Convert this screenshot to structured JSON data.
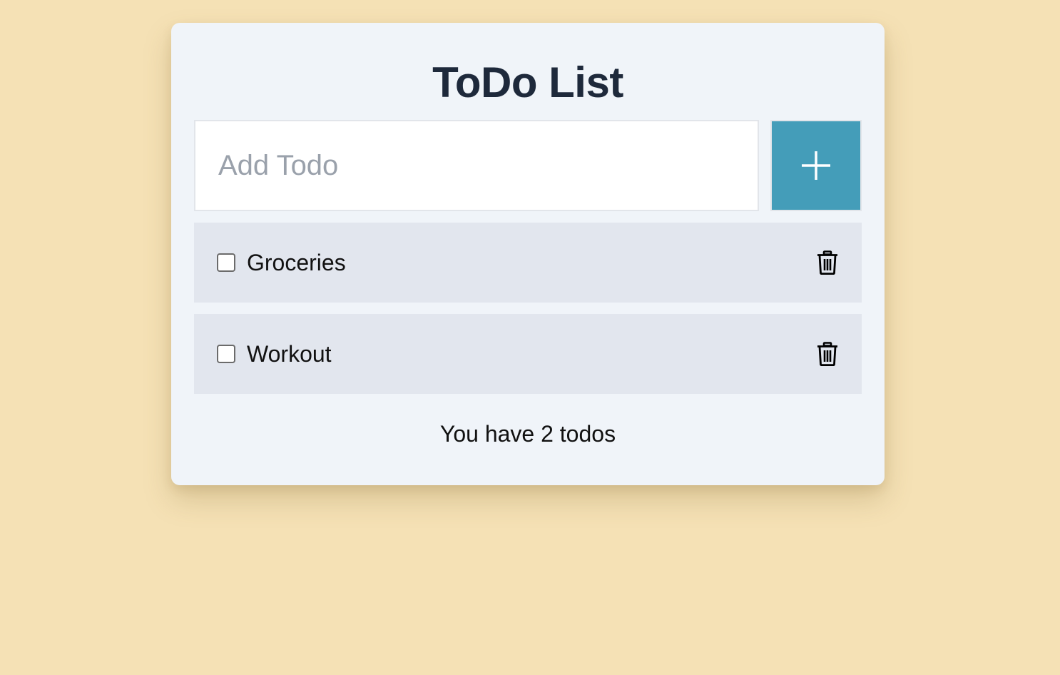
{
  "app": {
    "title": "ToDo List"
  },
  "input": {
    "placeholder": "Add Todo",
    "value": ""
  },
  "add_button": {
    "icon": "plus-icon"
  },
  "todos": [
    {
      "label": "Groceries",
      "checked": false,
      "delete_icon": "trash-icon"
    },
    {
      "label": "Workout",
      "checked": false,
      "delete_icon": "trash-icon"
    }
  ],
  "footer": {
    "count_text": "You have 2 todos"
  },
  "colors": {
    "background": "#f5e1b5",
    "card": "#f0f4f9",
    "accent": "#449db9",
    "item_bg": "#e2e6ee",
    "title": "#1e293b"
  }
}
